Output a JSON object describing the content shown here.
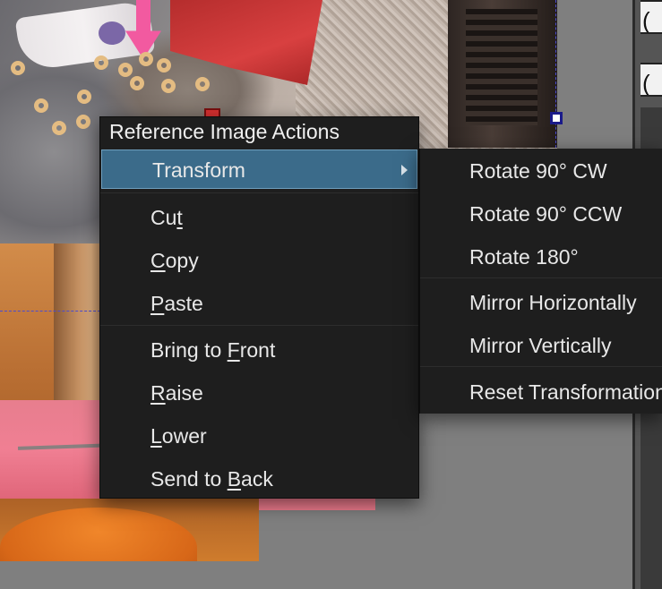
{
  "context_menu": {
    "title": "Reference Image Actions",
    "items": [
      {
        "label": "Transform",
        "has_submenu": true
      },
      {
        "pre": "Cu",
        "mnemonic": "t",
        "post": ""
      },
      {
        "pre": "",
        "mnemonic": "C",
        "post": "opy"
      },
      {
        "pre": "",
        "mnemonic": "P",
        "post": "aste"
      },
      {
        "pre": "Bring to ",
        "mnemonic": "F",
        "post": "ront"
      },
      {
        "pre": "",
        "mnemonic": "R",
        "post": "aise"
      },
      {
        "pre": "",
        "mnemonic": "L",
        "post": "ower"
      },
      {
        "pre": "Send to ",
        "mnemonic": "B",
        "post": "ack"
      }
    ]
  },
  "transform_submenu": {
    "items": [
      "Rotate 90° CW",
      "Rotate 90° CCW",
      "Rotate 180°",
      "Mirror Horizontally",
      "Mirror Vertically",
      "Reset Transformation"
    ]
  },
  "right_panel": {
    "slot_glyphs": [
      "(",
      "("
    ]
  },
  "colors": {
    "menu_bg": "#1e1e1e",
    "highlight": "#3b6b8a",
    "canvas_bg": "#7f7f7f"
  }
}
